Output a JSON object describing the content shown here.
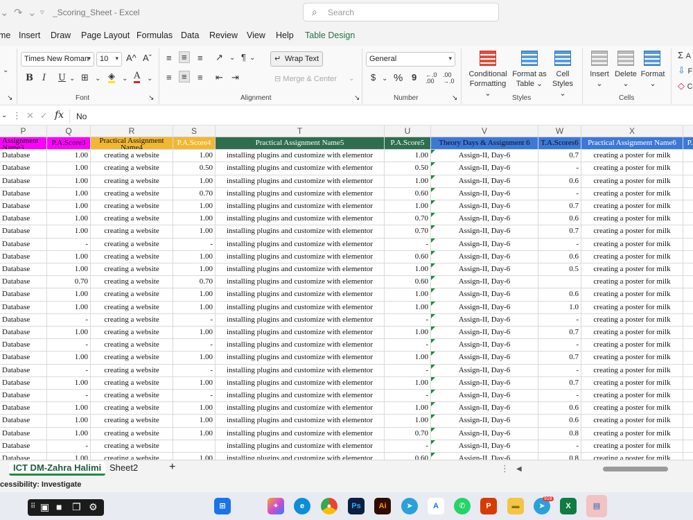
{
  "titlebar": {
    "undo_icon": "undo-icon",
    "redo_icon": "redo-icon",
    "title": "_Scoring_Sheet  -  Excel",
    "search_placeholder": "Search"
  },
  "tabs": [
    "me",
    "Insert",
    "Draw",
    "Page Layout",
    "Formulas",
    "Data",
    "Review",
    "View",
    "Help",
    "Table Design"
  ],
  "ribbon": {
    "font_name": "Times New Roman",
    "font_size": "10",
    "wrap_text": "Wrap Text",
    "merge_center": "Merge & Center",
    "number_format": "General",
    "groups": {
      "font": "Font",
      "alignment": "Alignment",
      "number": "Number",
      "styles": "Styles",
      "cells": "Cells"
    },
    "styles_buttons": [
      "Conditional Formatting",
      "Format as Table",
      "Cell Styles"
    ],
    "cells_buttons": [
      "Insert",
      "Delete",
      "Format"
    ],
    "bold": "B",
    "italic": "I",
    "underline": "U",
    "percent": "%",
    "comma": "9",
    "currency": "$",
    "dec_inc": "←.0 .00",
    "dec_dec": ".00 →.0",
    "edit_partial": [
      "A",
      "F",
      "C"
    ]
  },
  "formula_bar": {
    "fx": "fx",
    "value": "No"
  },
  "columns": [
    "P",
    "Q",
    "R",
    "S",
    "T",
    "U",
    "V",
    "W",
    "X",
    ""
  ],
  "header_row": [
    "Assignment Name3",
    "P.A.Score3",
    "Practical Assignment Name4",
    "P.A.Score4",
    "Practical Assignment Name5",
    "P.A.Score5",
    "Theory Days & Assignment 6",
    "T.A.Scores6",
    "Practical Assignment Name6",
    "P."
  ],
  "rows": [
    [
      "Database",
      "1.00",
      "creating a website",
      "1.00",
      "installing plugins and customize with elementor",
      "1.00",
      "Assign-II, Day-6",
      "0.7",
      "creating a poster for milk"
    ],
    [
      "Database",
      "1.00",
      "creating a website",
      "0.50",
      "installing plugins and customize with elementor",
      "0.50",
      "Assign-II, Day-6",
      "-",
      "creating a poster for milk"
    ],
    [
      "Database",
      "1.00",
      "creating a website",
      "1.00",
      "installing plugins and customize with elementor",
      "1.00",
      "Assign-II, Day-6",
      "0.6",
      "creating a poster for milk"
    ],
    [
      "Database",
      "1.00",
      "creating a website",
      "0.70",
      "installing plugins and customize with elementor",
      "0.60",
      "Assign-II, Day-6",
      "-",
      "creating a poster for milk"
    ],
    [
      "Database",
      "1.00",
      "creating a website",
      "1.00",
      "installing plugins and customize with elementor",
      "1.00",
      "Assign-II, Day-6",
      "0.7",
      "creating a poster for milk"
    ],
    [
      "Database",
      "1.00",
      "creating a website",
      "1.00",
      "installing plugins and customize with elementor",
      "0.70",
      "Assign-II, Day-6",
      "0.6",
      "creating a poster for milk"
    ],
    [
      "Database",
      "1.00",
      "creating a website",
      "1.00",
      "installing plugins and customize with elementor",
      "0.70",
      "Assign-II, Day-6",
      "0.7",
      "creating a poster for milk"
    ],
    [
      "Database",
      "-",
      "creating a website",
      "-",
      "installing plugins and customize with elementor",
      "-",
      "Assign-II, Day-6",
      "-",
      "creating a poster for milk"
    ],
    [
      "Database",
      "1.00",
      "creating a website",
      "1.00",
      "installing plugins and customize with elementor",
      "0.60",
      "Assign-II, Day-6",
      "0.6",
      "creating a poster for milk"
    ],
    [
      "Database",
      "1.00",
      "creating a website",
      "1.00",
      "installing plugins and customize with elementor",
      "1.00",
      "Assign-II, Day-6",
      "0.5",
      "creating a poster for milk"
    ],
    [
      "Database",
      "0.70",
      "creating a website",
      "0.70",
      "installing plugins and customize with elementor",
      "0.60",
      "Assign-II, Day-6",
      "",
      "creating a poster for milk"
    ],
    [
      "Database",
      "1.00",
      "creating a website",
      "1.00",
      "installing plugins and customize with elementor",
      "1.00",
      "Assign-II, Day-6",
      "0.6",
      "creating a poster for milk"
    ],
    [
      "Database",
      "1.00",
      "creating a website",
      "1.00",
      "installing plugins and customize with elementor",
      "1.00",
      "Assign-II, Day-6",
      "1.0",
      "creating a poster for milk"
    ],
    [
      "Database",
      "-",
      "creating a website",
      "-",
      "installing plugins and customize with elementor",
      "-",
      "Assign-II, Day-6",
      "-",
      "creating a poster for milk"
    ],
    [
      "Database",
      "1.00",
      "creating a website",
      "1.00",
      "installing plugins and customize with elementor",
      "1.00",
      "Assign-II, Day-6",
      "0.7",
      "creating a poster for milk"
    ],
    [
      "Database",
      "-",
      "creating a website",
      "-",
      "installing plugins and customize with elementor",
      "-",
      "Assign-II, Day-6",
      "-",
      "creating a poster for milk"
    ],
    [
      "Database",
      "1.00",
      "creating a website",
      "1.00",
      "installing plugins and customize with elementor",
      "1.00",
      "Assign-II, Day-6",
      "0.7",
      "creating a poster for milk"
    ],
    [
      "Database",
      "-",
      "creating a website",
      "-",
      "installing plugins and customize with elementor",
      "-",
      "Assign-II, Day-6",
      "-",
      "creating a poster for milk"
    ],
    [
      "Database",
      "1.00",
      "creating a website",
      "1.00",
      "installing plugins and customize with elementor",
      "1.00",
      "Assign-II, Day-6",
      "0.7",
      "creating a poster for milk"
    ],
    [
      "Database",
      "-",
      "creating a website",
      "-",
      "installing plugins and customize with elementor",
      "-",
      "Assign-II, Day-6",
      "-",
      "creating a poster for milk"
    ],
    [
      "Database",
      "1.00",
      "creating a website",
      "1.00",
      "installing plugins and customize with elementor",
      "1.00",
      "Assign-II, Day-6",
      "0.6",
      "creating a poster for milk"
    ],
    [
      "Database",
      "1.00",
      "creating a website",
      "1.00",
      "installing plugins and customize with elementor",
      "1.00",
      "Assign-II, Day-6",
      "0.6",
      "creating a poster for milk"
    ],
    [
      "Database",
      "1.00",
      "creating a website",
      "1.00",
      "installing plugins and customize with elementor",
      "0.70",
      "Assign-II, Day-6",
      "0.8",
      "creating a poster for milk"
    ],
    [
      "Database",
      "-",
      "creating a website",
      "",
      "installing plugins and customize with elementor",
      "-",
      "Assign-II, Day-6",
      "-",
      "creating a poster for milk"
    ],
    [
      "Database",
      "1.00",
      "creating a website",
      "1.00",
      "installing plugins and customize with elementor",
      "0.60",
      "Assign-II, Day-6",
      "0.8",
      "creating a poster for milk"
    ]
  ],
  "header_colors": [
    "#ff00ff",
    "#ff00ff",
    "#f2b731",
    "#f2b731",
    "#2e6e4e",
    "#2e6e4e",
    "#3c78d8",
    "#3c78d8",
    "#3c78d8",
    "#3c78d8"
  ],
  "header_text_colors": [
    "#111111",
    "#111111",
    "#111111",
    "#ffffff",
    "#ffffff",
    "#ffffff",
    "#111111",
    "#111111",
    "#ffffff",
    "#ffffff"
  ],
  "sheets": [
    "ICT DM-Zahra Halimi",
    "Sheet2"
  ],
  "add_sheet": "+",
  "status": "cessibility: Investigate",
  "taskbar_badge": "918"
}
